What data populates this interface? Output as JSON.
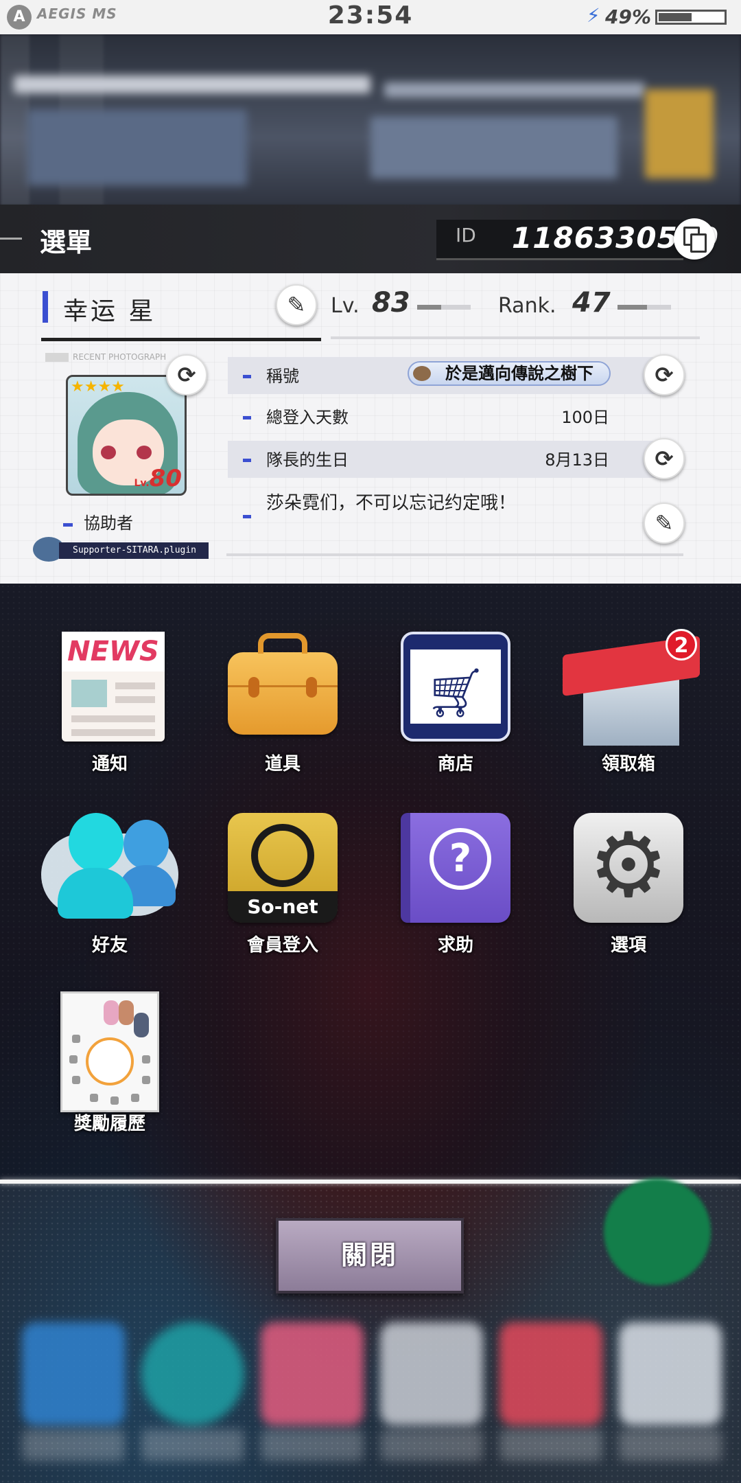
{
  "status_bar": {
    "brand": "AEGIS MS",
    "time": "23:54",
    "battery_percent": "49%",
    "battery_level": 0.49
  },
  "header": {
    "title": "選單",
    "id_label": "ID",
    "id_value": "1186330509"
  },
  "profile": {
    "name": "幸运 星",
    "level_label": "Lv.",
    "level_value": "83",
    "level_progress": 0.45,
    "rank_label": "Rank.",
    "rank_value": "47",
    "rank_progress": 0.55,
    "recent_photo_label": "RECENT PHOTOGRAPH",
    "card_level_label": "Lv.",
    "card_level_value": "80",
    "card_stars": "★★★★",
    "supporter_label": "協助者",
    "plugin_name": "Supporter-SITARA.plugin",
    "rows": [
      {
        "label": "稱號",
        "value": "於是邁向傳說之樹下"
      },
      {
        "label": "總登入天數",
        "value": "100日"
      },
      {
        "label": "隊長的生日",
        "value": "8月13日"
      }
    ],
    "message": "莎朵霓们，不可以忘记约定哦！"
  },
  "menu": [
    {
      "label": "通知",
      "icon": "news-icon"
    },
    {
      "label": "道具",
      "icon": "briefcase-icon"
    },
    {
      "label": "商店",
      "icon": "shopping-cart-icon"
    },
    {
      "label": "領取箱",
      "icon": "gift-box-icon",
      "badge": "2"
    },
    {
      "label": "好友",
      "icon": "friends-icon"
    },
    {
      "label": "會員登入",
      "icon": "sonet-icon",
      "icon_text": "So-net"
    },
    {
      "label": "求助",
      "icon": "help-book-icon"
    },
    {
      "label": "選項",
      "icon": "gear-icon"
    },
    {
      "label": "獎勵履歷",
      "icon": "reward-history-icon"
    }
  ],
  "news_icon_text": "NEWS",
  "close_button": "關閉",
  "colors": {
    "accent": "#3b4fd1",
    "header_bg": "#232428",
    "badge_red": "#e01b2a"
  }
}
